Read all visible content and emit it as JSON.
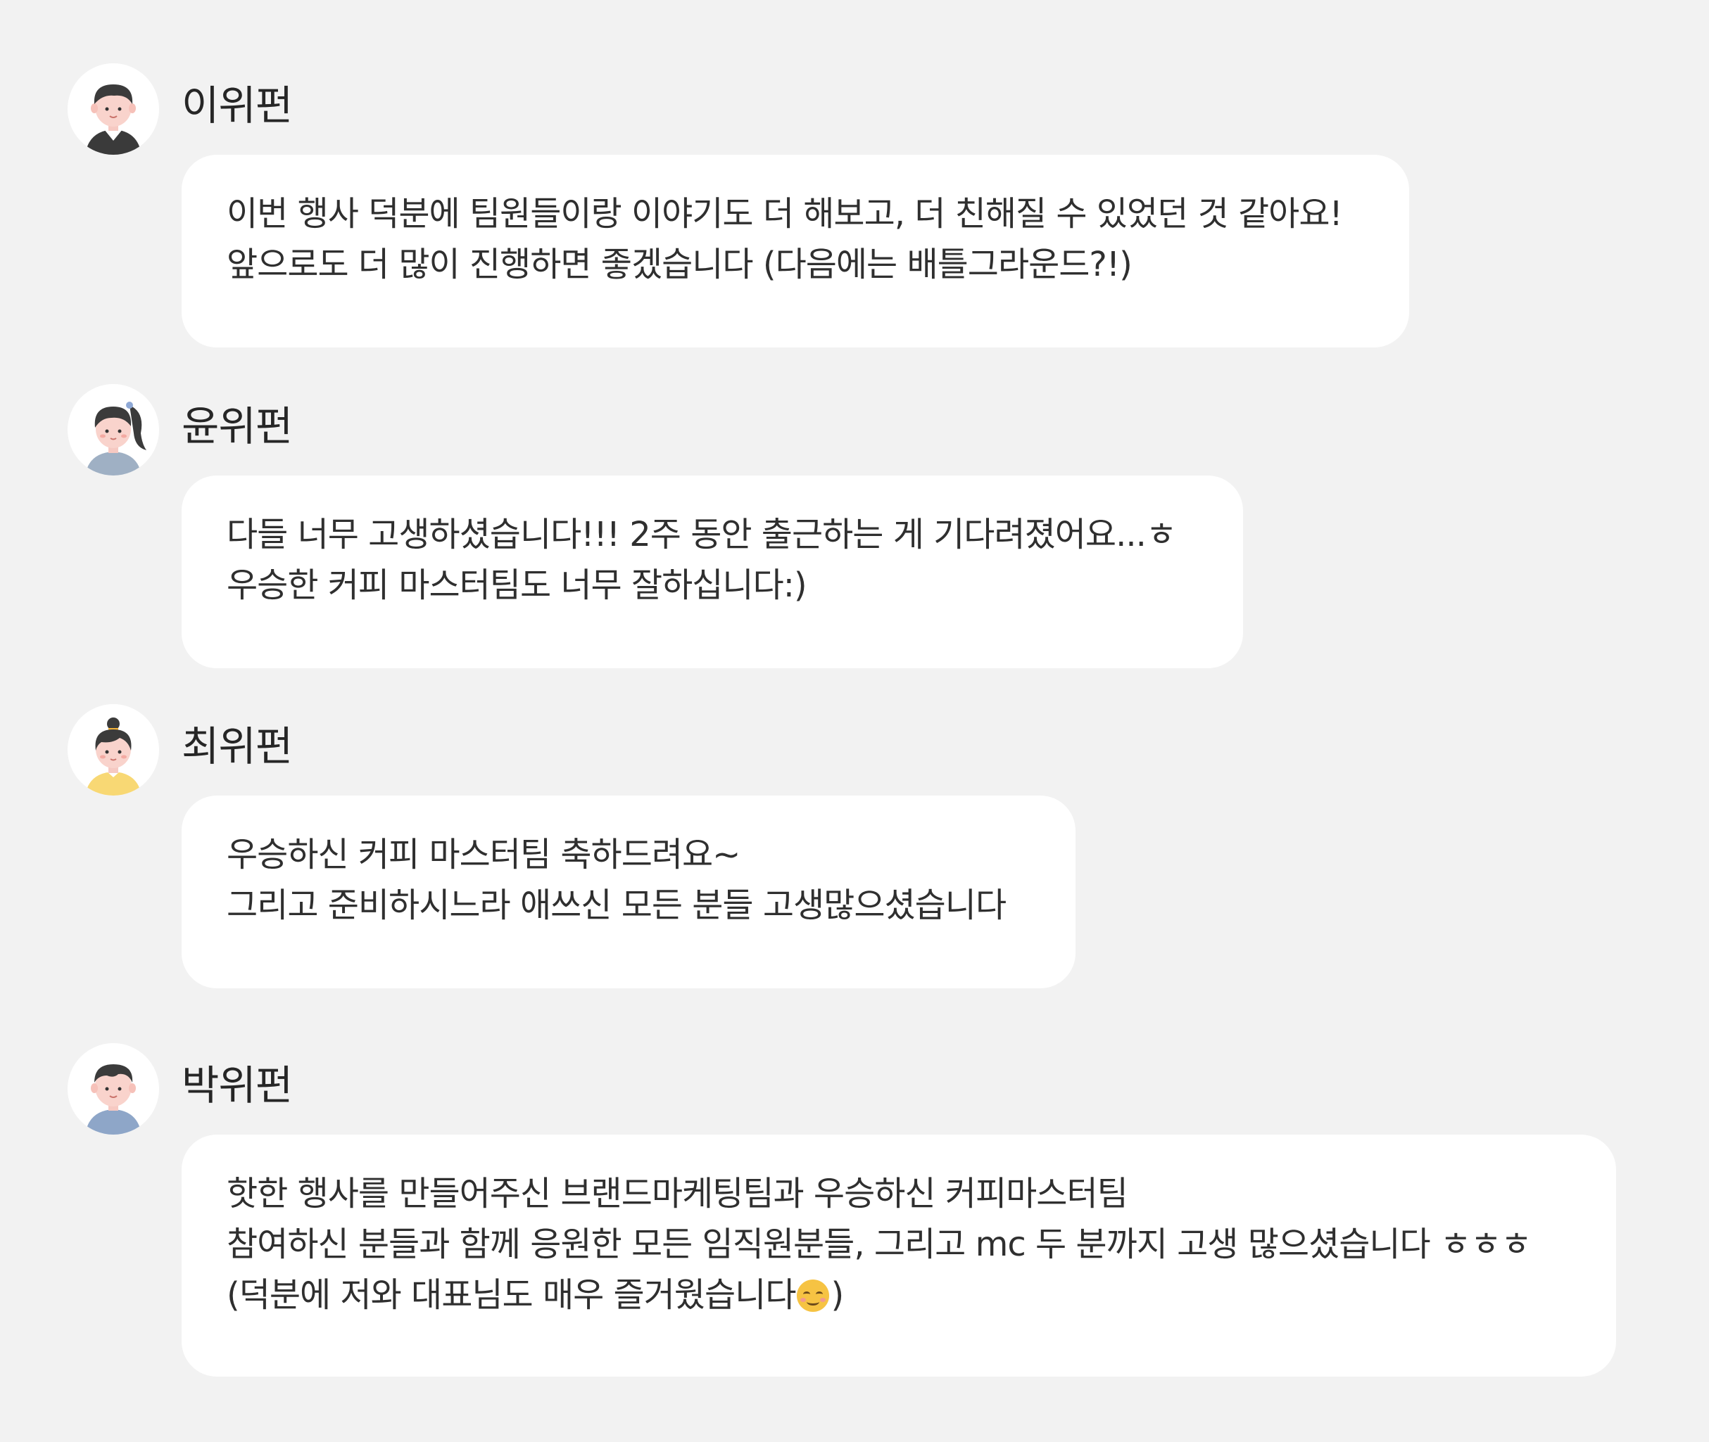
{
  "messages": [
    {
      "author": "이위펀",
      "avatar_icon": "boy-dark-shirt-avatar-icon",
      "lines": [
        "이번 행사 덕분에 팀원들이랑 이야기도 더 해보고, 더 친해질 수 있었던 것 같아요!",
        "앞으로도 더 많이 진행하면 좋겠습니다 (다음에는 배틀그라운드?!)"
      ]
    },
    {
      "author": "윤위펀",
      "avatar_icon": "girl-ponytail-avatar-icon",
      "lines": [
        "다들 너무 고생하셨습니다!!! 2주 동안 출근하는 게 기다려졌어요...ㅎ",
        "우승한 커피 마스터팀도 너무 잘하십니다:)"
      ]
    },
    {
      "author": "최위펀",
      "avatar_icon": "girl-bun-avatar-icon",
      "lines": [
        "우승하신 커피 마스터팀 축하드려요~",
        "그리고 준비하시느라 애쓰신 모든 분들 고생많으셨습니다"
      ]
    },
    {
      "author": "박위펀",
      "avatar_icon": "boy-blue-shirt-avatar-icon",
      "lines": [
        "핫한 행사를 만들어주신 브랜드마케팅팀과 우승하신 커피마스터팀",
        "참여하신 분들과 함께 응원한 모든 임직원분들, 그리고 mc 두 분까지 고생 많으셨습니다 ㅎㅎㅎ",
        "(덕분에 저와 대표님도 매우 즐거웠습니다",
        ")"
      ],
      "emoji_icon": "smiling-face-emoji-icon"
    }
  ],
  "colors": {
    "background": "#f2f2f2",
    "bubble": "#ffffff",
    "text": "#2f2f2f"
  }
}
